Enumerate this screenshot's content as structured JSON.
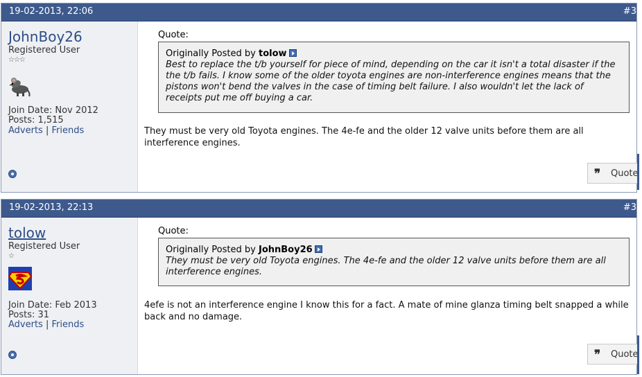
{
  "posts": [
    {
      "date": "19-02-2013, 22:06",
      "post_number": "#3",
      "username": "JohnBoy26",
      "user_title": "Registered User",
      "stars": "☆☆☆",
      "join_date": "Join Date: Nov 2012",
      "posts_count": "Posts: 1,515",
      "link_adverts": "Adverts",
      "link_sep": "|",
      "link_friends": "Friends",
      "quote_label": "Quote:",
      "quote_posted_by": "Originally Posted by",
      "quote_author": "tolow",
      "quote_text": "Best to replace the t/b yourself for piece of mind, depending on the car it isn't a total disaster if the the t/b fails. I know some of the older toyota engines are non-interference engines means that the pistons won't bend the valves in the case of timing belt failure. I also wouldn't let the lack of receipts put me off buying a car.",
      "message": "They must be very old Toyota engines. The 4e-fe and the older 12 valve units before them are all interference engines.",
      "quote_button": "Quote",
      "avatar_icon": "rat-icon"
    },
    {
      "date": "19-02-2013, 22:13",
      "post_number": "#3",
      "username": "tolow",
      "user_title": "Registered User",
      "stars": "☆",
      "join_date": "Join Date: Feb 2013",
      "posts_count": "Posts: 31",
      "link_adverts": "Adverts",
      "link_sep": "|",
      "link_friends": "Friends",
      "quote_label": "Quote:",
      "quote_posted_by": "Originally Posted by",
      "quote_author": "JohnBoy26",
      "quote_text": "They must be very old Toyota engines. The 4e-fe and the older 12 valve units before them are all interference engines.",
      "message": "4efe is not an interference engine I know this for a fact. A mate of mine glanza timing belt snapped a while back and no damage.",
      "quote_button": "Quote",
      "avatar_icon": "superman-icon"
    }
  ],
  "colors": {
    "header_bg": "#3e5a8c",
    "link": "#2d4d86",
    "sidebar_bg": "#eef0f3",
    "quote_bg": "#f0f0f0"
  }
}
